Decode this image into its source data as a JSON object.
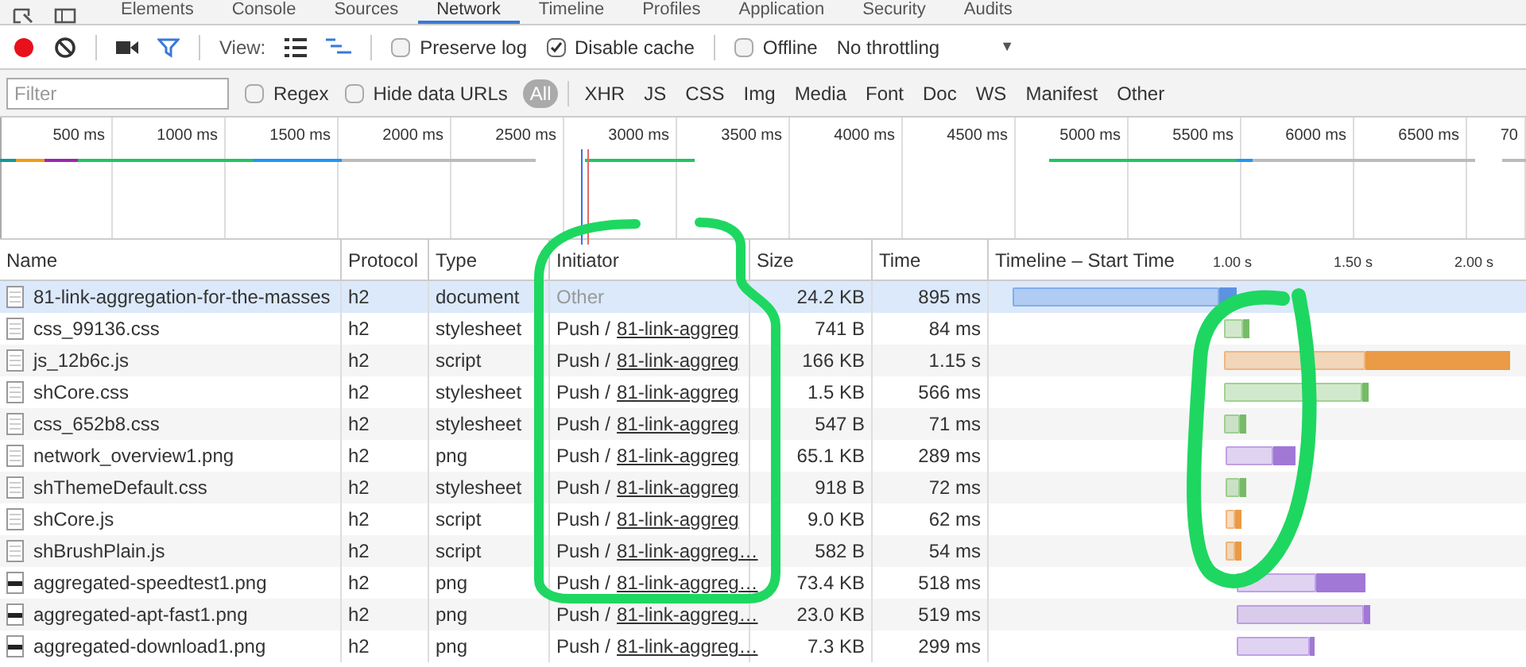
{
  "panel_tabs": [
    {
      "label": "Elements",
      "selected": false
    },
    {
      "label": "Console",
      "selected": false
    },
    {
      "label": "Sources",
      "selected": false
    },
    {
      "label": "Network",
      "selected": true
    },
    {
      "label": "Timeline",
      "selected": false
    },
    {
      "label": "Profiles",
      "selected": false
    },
    {
      "label": "Application",
      "selected": false
    },
    {
      "label": "Security",
      "selected": false
    },
    {
      "label": "Audits",
      "selected": false
    }
  ],
  "toolbar": {
    "view_label": "View:",
    "preserve_log": {
      "label": "Preserve log",
      "checked": false
    },
    "disable_cache": {
      "label": "Disable cache",
      "checked": true
    },
    "offline": {
      "label": "Offline",
      "checked": false
    },
    "throttling": "No throttling",
    "dropdown_arrow": "▼"
  },
  "filter_bar": {
    "placeholder": "Filter",
    "regex": {
      "label": "Regex",
      "checked": false
    },
    "hide_data_urls": {
      "label": "Hide data URLs",
      "checked": false
    },
    "types": [
      {
        "label": "All",
        "selected": true
      },
      {
        "label": "XHR",
        "selected": false
      },
      {
        "label": "JS",
        "selected": false
      },
      {
        "label": "CSS",
        "selected": false
      },
      {
        "label": "Img",
        "selected": false
      },
      {
        "label": "Media",
        "selected": false
      },
      {
        "label": "Font",
        "selected": false
      },
      {
        "label": "Doc",
        "selected": false
      },
      {
        "label": "WS",
        "selected": false
      },
      {
        "label": "Manifest",
        "selected": false
      },
      {
        "label": "Other",
        "selected": false
      }
    ]
  },
  "overview_ticks": [
    "500 ms",
    "1000 ms",
    "1500 ms",
    "2000 ms",
    "2500 ms",
    "3000 ms",
    "3500 ms",
    "4000 ms",
    "4500 ms",
    "5000 ms",
    "5500 ms",
    "6000 ms",
    "6500 ms",
    "70"
  ],
  "table": {
    "columns": [
      "Name",
      "Protocol",
      "Type",
      "Initiator",
      "Size",
      "Time",
      "Timeline – Start Time"
    ],
    "timeline_ticks": [
      "1.00 s",
      "1.50 s",
      "2.00 s"
    ],
    "rows": [
      {
        "name": "81-link-aggregation-for-the-masses",
        "protocol": "h2",
        "type": "document",
        "initiator_prefix": "Other",
        "initiator_link": "",
        "size": "24.2 KB",
        "time": "895 ms",
        "selected": true,
        "color": "#5b93e0"
      },
      {
        "name": "css_99136.css",
        "protocol": "h2",
        "type": "stylesheet",
        "initiator_prefix": "Push /",
        "initiator_link": "81-link-aggreg",
        "size": "741 B",
        "time": "84 ms",
        "selected": false,
        "color": "#77bb66"
      },
      {
        "name": "js_12b6c.js",
        "protocol": "h2",
        "type": "script",
        "initiator_prefix": "Push /",
        "initiator_link": "81-link-aggreg",
        "size": "166 KB",
        "time": "1.15 s",
        "selected": false,
        "color": "#eb9a45"
      },
      {
        "name": "shCore.css",
        "protocol": "h2",
        "type": "stylesheet",
        "initiator_prefix": "Push /",
        "initiator_link": "81-link-aggreg",
        "size": "1.5 KB",
        "time": "566 ms",
        "selected": false,
        "color": "#77bb66"
      },
      {
        "name": "css_652b8.css",
        "protocol": "h2",
        "type": "stylesheet",
        "initiator_prefix": "Push /",
        "initiator_link": "81-link-aggreg",
        "size": "547 B",
        "time": "71 ms",
        "selected": false,
        "color": "#77bb66"
      },
      {
        "name": "network_overview1.png",
        "protocol": "h2",
        "type": "png",
        "initiator_prefix": "Push /",
        "initiator_link": "81-link-aggreg",
        "size": "65.1 KB",
        "time": "289 ms",
        "selected": false,
        "color": "#a178d6"
      },
      {
        "name": "shThemeDefault.css",
        "protocol": "h2",
        "type": "stylesheet",
        "initiator_prefix": "Push /",
        "initiator_link": "81-link-aggreg",
        "size": "918 B",
        "time": "72 ms",
        "selected": false,
        "color": "#77bb66"
      },
      {
        "name": "shCore.js",
        "protocol": "h2",
        "type": "script",
        "initiator_prefix": "Push /",
        "initiator_link": "81-link-aggreg",
        "size": "9.0 KB",
        "time": "62 ms",
        "selected": false,
        "color": "#eb9a45"
      },
      {
        "name": "shBrushPlain.js",
        "protocol": "h2",
        "type": "script",
        "initiator_prefix": "Push /",
        "initiator_link": "81-link-aggreg…",
        "size": "582 B",
        "time": "54 ms",
        "selected": false,
        "color": "#eb9a45"
      },
      {
        "name": "aggregated-speedtest1.png",
        "protocol": "h2",
        "type": "png",
        "initiator_prefix": "Push /",
        "initiator_link": "81-link-aggreg…",
        "size": "73.4 KB",
        "time": "518 ms",
        "selected": false,
        "color": "#a178d6"
      },
      {
        "name": "aggregated-apt-fast1.png",
        "protocol": "h2",
        "type": "png",
        "initiator_prefix": "Push /",
        "initiator_link": "81-link-aggreg…",
        "size": "23.0 KB",
        "time": "519 ms",
        "selected": false,
        "color": "#a178d6"
      },
      {
        "name": "aggregated-download1.png",
        "protocol": "h2",
        "type": "png",
        "initiator_prefix": "Push /",
        "initiator_link": "81-link-aggreg…",
        "size": "7.3 KB",
        "time": "299 ms",
        "selected": false,
        "color": "#a178d6"
      }
    ]
  }
}
